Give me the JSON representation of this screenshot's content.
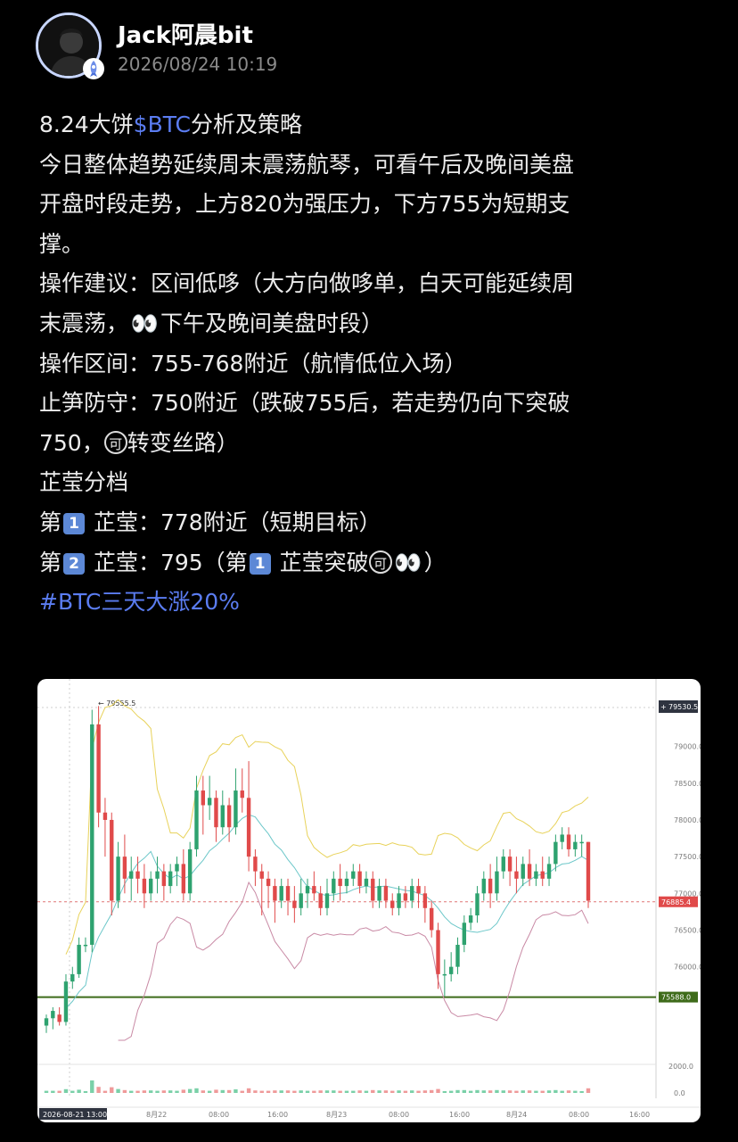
{
  "post": {
    "author": "Jack阿晨bit",
    "timestamp": "2026/08/24 10:19",
    "title_prefix": "8.24大饼",
    "title_link": "$BTC",
    "title_suffix": "分析及策略",
    "lines": [
      "今日整体趋势延续周末震荡航琴，可看午后及晚间美盘",
      "开盘时段走势，上方820为强压力，下方755为短期支",
      "撑。",
      "操作建议：区间低哆（大方向做哆单，白天可能延续周",
      "末震荡，",
      "下午及晚间美盘时段）",
      "操作区间：755-768附近（航情低位入场）",
      "止笋防守：750附近（跌破755后，若走势仍向下突破",
      "750，",
      "转变丝路）",
      "芷莹分档",
      "第",
      "芷莹：778附近（短期目标）",
      "第",
      "芷莹：795（第",
      "芷莹突破",
      "）"
    ],
    "keycap_1": "1",
    "keycap_2": "2",
    "circled": "可",
    "eyes": "👀",
    "hashtag": "#BTC三天大涨20%"
  },
  "chart_data": {
    "type": "candlestick",
    "title": "",
    "y_ticks": [
      76000.0,
      76500.0,
      77000.0,
      77500.0,
      78000.0,
      78500.0,
      79000.0
    ],
    "x_ticks": [
      "2026-08-21 13:00",
      "8月22",
      "08:00",
      "16:00",
      "8月23",
      "08:00",
      "16:00",
      "8月24",
      "08:00",
      "16:00"
    ],
    "price_labels": {
      "high_marker": "79555.5",
      "top_right": "79530.5",
      "current": "76885.4",
      "support_line": "75588.0"
    },
    "volume_ticks": [
      "2000.0",
      "0.0"
    ],
    "ylim": [
      75000,
      79700
    ],
    "support_level": 75588.0,
    "current_level": 76885.4,
    "candles": [
      [
        75200,
        75300,
        75100,
        75350
      ],
      [
        75300,
        75400,
        75150,
        75450
      ],
      [
        75350,
        75250,
        75200,
        75450
      ],
      [
        75250,
        75800,
        75200,
        75900
      ],
      [
        75800,
        75900,
        75700,
        76000
      ],
      [
        75900,
        76300,
        75850,
        76400
      ],
      [
        76300,
        76300,
        76200,
        76400
      ],
      [
        76300,
        79300,
        76200,
        79500
      ],
      [
        79300,
        78100,
        77900,
        79550
      ],
      [
        78100,
        78000,
        77500,
        78300
      ],
      [
        78000,
        76900,
        76700,
        78100
      ],
      [
        76900,
        77500,
        76800,
        77700
      ],
      [
        77500,
        77200,
        77000,
        77800
      ],
      [
        77200,
        77300,
        76900,
        77500
      ],
      [
        77300,
        77200,
        77000,
        77500
      ],
      [
        77200,
        77000,
        76800,
        77400
      ],
      [
        77000,
        77200,
        76900,
        77300
      ],
      [
        77200,
        77300,
        77000,
        77500
      ],
      [
        77300,
        77100,
        76900,
        77400
      ],
      [
        77100,
        77300,
        77000,
        77400
      ],
      [
        77300,
        77400,
        77100,
        77500
      ],
      [
        77400,
        77000,
        76900,
        77600
      ],
      [
        77000,
        77600,
        76900,
        77700
      ],
      [
        77600,
        78400,
        77500,
        78600
      ],
      [
        78400,
        78200,
        77800,
        78600
      ],
      [
        78200,
        78300,
        78000,
        78600
      ],
      [
        78300,
        77900,
        77700,
        78400
      ],
      [
        77900,
        78200,
        77800,
        78400
      ],
      [
        78200,
        77900,
        77700,
        78300
      ],
      [
        77900,
        78400,
        77800,
        78700
      ],
      [
        78400,
        78300,
        78100,
        78700
      ],
      [
        78300,
        77500,
        77300,
        78800
      ],
      [
        77500,
        77300,
        77100,
        77600
      ],
      [
        77300,
        77200,
        76700,
        77400
      ],
      [
        77200,
        77100,
        76800,
        77300
      ],
      [
        77100,
        76900,
        76600,
        77200
      ],
      [
        76900,
        77100,
        76800,
        77200
      ],
      [
        77100,
        76900,
        76700,
        77200
      ],
      [
        76900,
        76800,
        76600,
        77100
      ],
      [
        76800,
        77000,
        76700,
        77200
      ],
      [
        77000,
        77100,
        76800,
        77200
      ],
      [
        77100,
        77000,
        76900,
        77300
      ],
      [
        77000,
        76800,
        76700,
        77100
      ],
      [
        76800,
        77000,
        76700,
        77200
      ],
      [
        77000,
        77200,
        76900,
        77300
      ],
      [
        77200,
        77100,
        76900,
        77400
      ],
      [
        77100,
        77200,
        77000,
        77300
      ],
      [
        77200,
        77300,
        77100,
        77400
      ],
      [
        77300,
        77100,
        77000,
        77400
      ],
      [
        77100,
        77200,
        77000,
        77300
      ],
      [
        77200,
        76900,
        76800,
        77300
      ],
      [
        76900,
        77100,
        76800,
        77200
      ],
      [
        77100,
        76900,
        76800,
        77200
      ],
      [
        76900,
        76800,
        76700,
        77000
      ],
      [
        76800,
        77000,
        76700,
        77100
      ],
      [
        77000,
        76900,
        76800,
        77100
      ],
      [
        76900,
        77100,
        76800,
        77200
      ],
      [
        77100,
        77000,
        76800,
        77200
      ],
      [
        77000,
        76800,
        76600,
        77100
      ],
      [
        76800,
        76500,
        76400,
        76900
      ],
      [
        76500,
        75900,
        75700,
        76600
      ],
      [
        75900,
        75900,
        75600,
        76100
      ],
      [
        75900,
        76000,
        75800,
        76200
      ],
      [
        76000,
        76300,
        75900,
        76400
      ],
      [
        76300,
        76600,
        76200,
        76700
      ],
      [
        76600,
        76700,
        76500,
        76800
      ],
      [
        76700,
        77000,
        76600,
        77100
      ],
      [
        77000,
        77200,
        76900,
        77300
      ],
      [
        77200,
        77000,
        76800,
        77400
      ],
      [
        77000,
        77300,
        76900,
        77500
      ],
      [
        77300,
        77500,
        77200,
        77600
      ],
      [
        77500,
        77300,
        77100,
        77600
      ],
      [
        77300,
        77200,
        77000,
        77500
      ],
      [
        77200,
        77400,
        77100,
        77500
      ],
      [
        77400,
        77200,
        77100,
        77600
      ],
      [
        77200,
        77300,
        77100,
        77400
      ],
      [
        77300,
        77200,
        77100,
        77500
      ],
      [
        77200,
        77400,
        77100,
        77500
      ],
      [
        77400,
        77700,
        77300,
        77800
      ],
      [
        77700,
        77800,
        77600,
        77900
      ],
      [
        77800,
        77600,
        77500,
        77900
      ],
      [
        77600,
        77700,
        77500,
        77800
      ],
      [
        77700,
        77700,
        77500,
        77800
      ],
      [
        77700,
        76900,
        76800,
        77700
      ]
    ]
  }
}
